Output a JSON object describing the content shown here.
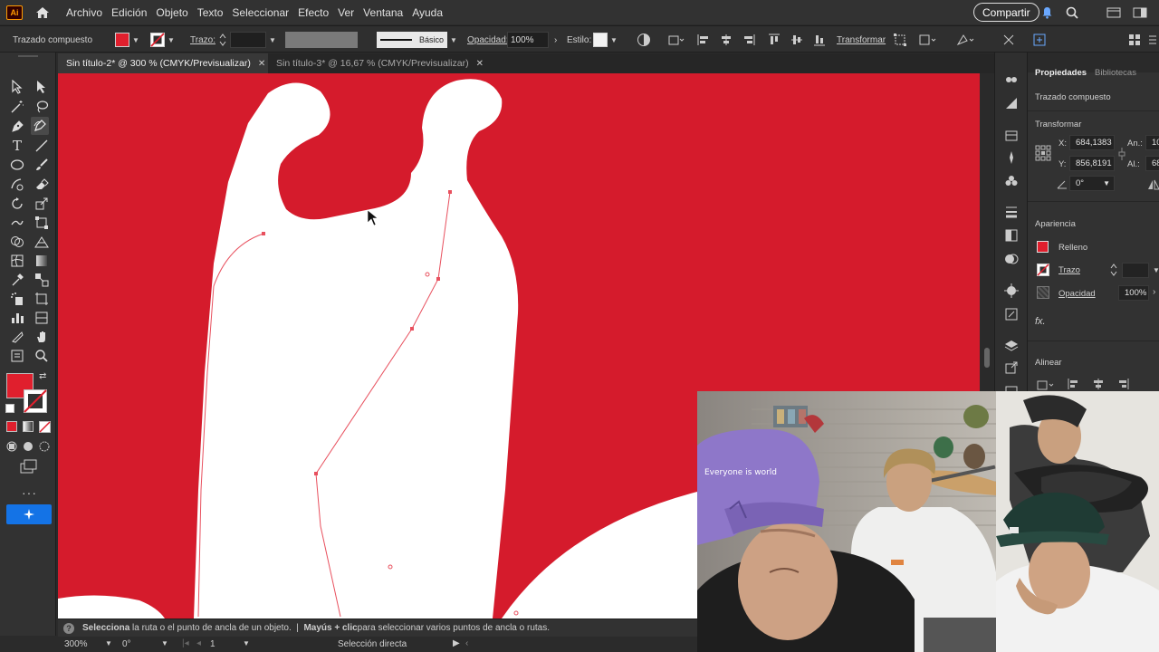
{
  "menubar": {
    "app_logo": "Ai",
    "items": [
      "Archivo",
      "Edición",
      "Objeto",
      "Texto",
      "Seleccionar",
      "Efecto",
      "Ver",
      "Ventana",
      "Ayuda"
    ],
    "share_label": "Compartir"
  },
  "controlbar": {
    "selection_type": "Trazado compuesto",
    "stroke_label": "Trazo:",
    "profile_label": "Básico",
    "opacity_label": "Opacidad:",
    "opacity_value": "100%",
    "style_label": "Estilo:",
    "transform_label": "Transformar"
  },
  "tabs": [
    {
      "label": "Sin título-2* @ 300 % (CMYK/Previsualizar)",
      "active": true
    },
    {
      "label": "Sin título-3* @ 16,67 % (CMYK/Previsualizar)",
      "active": false
    }
  ],
  "properties": {
    "tab_properties": "Propiedades",
    "tab_libraries": "Bibliotecas",
    "selection_type": "Trazado compuesto",
    "transform_title": "Transformar",
    "x_label": "X:",
    "x_value": "684,1383 p",
    "y_label": "Y:",
    "y_value": "856,8191 p",
    "width_label": "An.:",
    "width_value": "10",
    "height_label": "Al.:",
    "height_value": "68",
    "rotation_value": "0°",
    "appearance_title": "Apariencia",
    "fill_label": "Relleno",
    "stroke_label": "Trazo",
    "opacity_label": "Opacidad",
    "opacity_value": "100%",
    "fx_label": "fx.",
    "align_title": "Alinear"
  },
  "statusbar": {
    "help_bold_1": "Selecciona",
    "help_text_1": " la ruta o el punto de ancla de un objeto.  |  ",
    "help_bold_2": "Mayús + clic",
    "help_text_2": " para seleccionar varios puntos de ancla o rutas."
  },
  "bottombar": {
    "zoom": "300%",
    "rotation": "0°",
    "artboard": "1",
    "tool_name": "Selección directa"
  },
  "webcam": {
    "cap_text": "Everyone is world"
  },
  "colors": {
    "canvas_red": "#d51b2c",
    "fill_red": "#e01f2d",
    "path_outline": "#e8505e",
    "ui_dark": "#323232"
  }
}
